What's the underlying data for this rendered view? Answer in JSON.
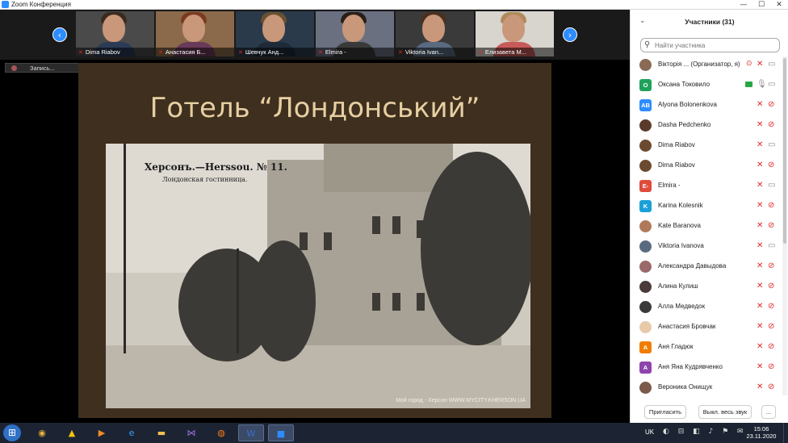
{
  "window": {
    "title": "Zoom Конференция",
    "controls": [
      "—",
      "☐",
      "✕"
    ]
  },
  "video_strip": {
    "prev_icon": "‹",
    "next_icon": "›",
    "tiles": [
      {
        "name": "Dima Riabov"
      },
      {
        "name": "Анастасия Б..."
      },
      {
        "name": "Шевчук Анд..."
      },
      {
        "name": "Elmira -"
      },
      {
        "name": "Viktoria Ivan..."
      },
      {
        "name": "Елизавета М..."
      }
    ]
  },
  "recording": {
    "label": "Запись..."
  },
  "slide": {
    "title": "Готель “Лондонський”",
    "photo_caption_1": "Херсонъ.—Herssou. № 11.",
    "photo_caption_2": "Лондонская гостинница.",
    "photo_credit": "Мой город - Херсон   WWW.MYCITY.KHERSON.UA"
  },
  "participants": {
    "header": "Участники (31)",
    "collapse_icon": "chevron-down-icon",
    "search_placeholder": "Найти участника",
    "list": [
      {
        "name": "Вікторія ... (Организатор, я)",
        "avatar": "",
        "color": "#8a6a55",
        "mic": "muted",
        "video": "on"
      },
      {
        "name": "Оксана Токовило",
        "avatar": "О",
        "color": "#1fa15a",
        "mic": "on",
        "video": "on",
        "sharing": true
      },
      {
        "name": "Alyona Bolonenkova",
        "avatar": "AB",
        "color": "#2d8cff",
        "mic": "muted",
        "video": "off"
      },
      {
        "name": "Dasha Pedchenko",
        "avatar": "",
        "color": "#5a3b2b",
        "mic": "muted",
        "video": "off"
      },
      {
        "name": "Dima Riabov",
        "avatar": "",
        "color": "#6b4a30",
        "mic": "muted",
        "video": "on"
      },
      {
        "name": "Dima Riabov",
        "avatar": "",
        "color": "#6b4a30",
        "mic": "muted",
        "video": "off"
      },
      {
        "name": "Elmira -",
        "avatar": "E-",
        "color": "#e04b3a",
        "mic": "muted",
        "video": "on"
      },
      {
        "name": "Karina Kolesnik",
        "avatar": "K",
        "color": "#1aa0d8",
        "mic": "muted",
        "video": "off"
      },
      {
        "name": "Kate Baranova",
        "avatar": "",
        "color": "#b07a5a",
        "mic": "muted",
        "video": "off"
      },
      {
        "name": "Viktoria Ivanova",
        "avatar": "",
        "color": "#5a6a80",
        "mic": "muted",
        "video": "on"
      },
      {
        "name": "Александра Давыдова",
        "avatar": "",
        "color": "#9a6a6a",
        "mic": "muted",
        "video": "off"
      },
      {
        "name": "Алина Кулиш",
        "avatar": "",
        "color": "#4a3a3a",
        "mic": "muted",
        "video": "off"
      },
      {
        "name": "Алла Медведок",
        "avatar": "",
        "color": "#3a3a3a",
        "mic": "muted",
        "video": "off"
      },
      {
        "name": "Анастасия Бровчак",
        "avatar": "",
        "color": "#e8c9a8",
        "mic": "muted",
        "video": "off"
      },
      {
        "name": "Аня Гладюк",
        "avatar": "A",
        "color": "#f07d00",
        "mic": "muted",
        "video": "off"
      },
      {
        "name": "Аня Яна Кудрявченко",
        "avatar": "A",
        "color": "#8e44ad",
        "mic": "muted",
        "video": "off"
      },
      {
        "name": "Вероника Онищук",
        "avatar": "",
        "color": "#7a5a4a",
        "mic": "muted",
        "video": "off"
      }
    ],
    "invite_label": "Пригласить",
    "mute_all_label": "Выкл. весь звук",
    "more_label": "..."
  },
  "taskbar": {
    "start_icon": "windows-logo-icon",
    "apps": [
      {
        "name": "chrome",
        "glyph": "◉",
        "color": "#e8b33a"
      },
      {
        "name": "drive",
        "glyph": "▲",
        "color": "#f4c20d"
      },
      {
        "name": "media-player",
        "glyph": "▶",
        "color": "#f28c28"
      },
      {
        "name": "internet-explorer",
        "glyph": "e",
        "color": "#3aa0ff"
      },
      {
        "name": "file-explorer",
        "glyph": "▬",
        "color": "#f2c14e"
      },
      {
        "name": "visual-studio",
        "glyph": "⋈",
        "color": "#a070e0"
      },
      {
        "name": "firefox",
        "glyph": "◍",
        "color": "#ff7a1a"
      },
      {
        "name": "word",
        "glyph": "W",
        "color": "#3a6fd0"
      },
      {
        "name": "zoom",
        "glyph": "■",
        "color": "#2d8cff"
      }
    ],
    "lang": "UK",
    "tray_icons": "◐ ⊟ ◧ ♪ ⚑ ✉",
    "time": "15:06",
    "date": "23.11.2020"
  }
}
